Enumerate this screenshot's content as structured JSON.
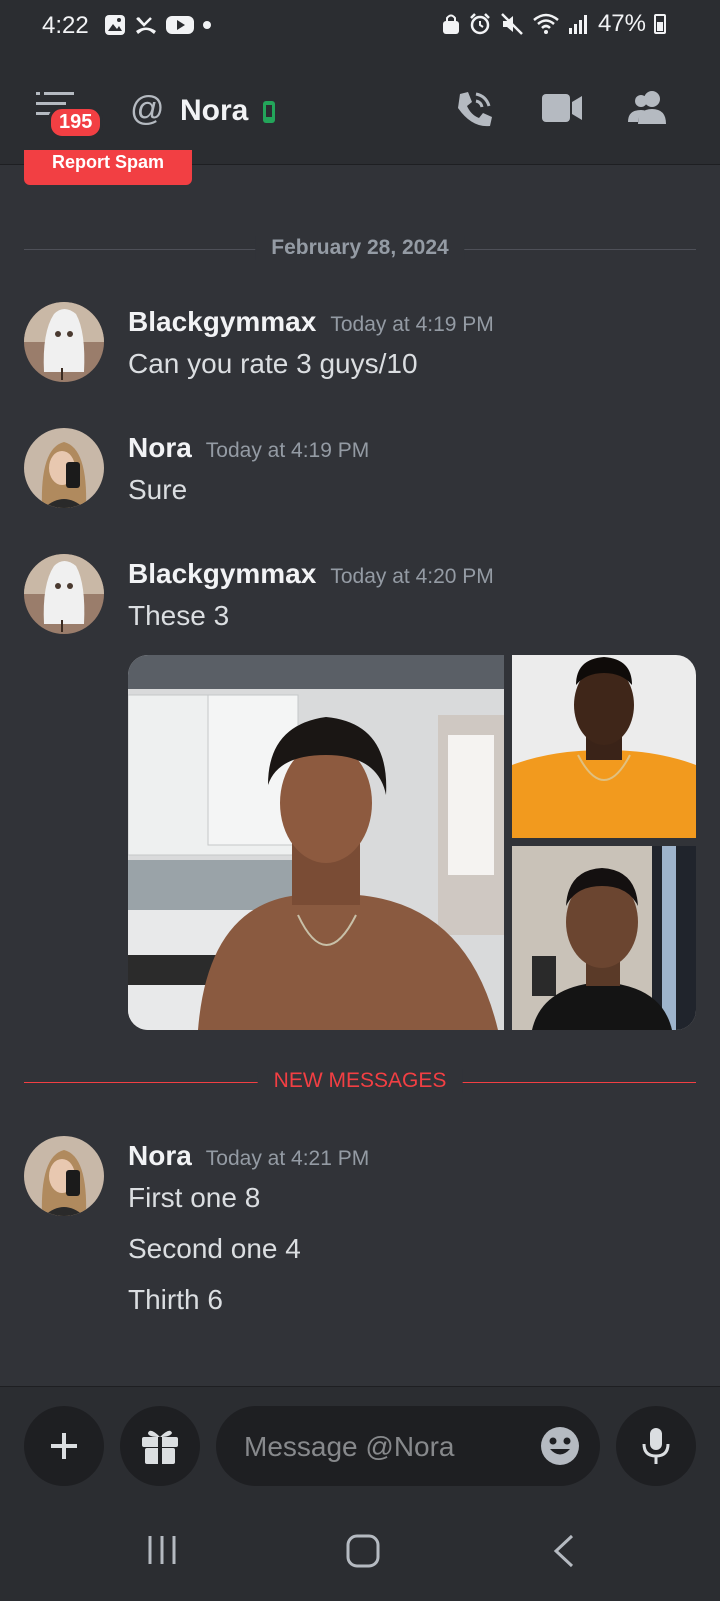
{
  "status_bar": {
    "time": "4:22",
    "battery_percent": "47%"
  },
  "header": {
    "unread_count": "195",
    "name": "Nora",
    "at_symbol": "@"
  },
  "report_button": {
    "label": "Report Spam"
  },
  "date_separator": "February 28, 2024",
  "new_messages_label": "NEW MESSAGES",
  "messages": [
    {
      "author": "Blackgymmax",
      "timestamp": "Today at 4:19 PM",
      "lines": [
        "Can you rate 3 guys/10"
      ]
    },
    {
      "author": "Nora",
      "timestamp": "Today at 4:19 PM",
      "lines": [
        "Sure"
      ]
    },
    {
      "author": "Blackgymmax",
      "timestamp": "Today at 4:20 PM",
      "lines": [
        "These 3"
      ]
    },
    {
      "author": "Nora",
      "timestamp": "Today at 4:21 PM",
      "lines": [
        "First one 8",
        "Second one 4",
        "Thirth 6"
      ]
    }
  ],
  "composer": {
    "placeholder": "Message @Nora"
  },
  "colors": {
    "background": "#313338",
    "header": "#2b2d31",
    "red": "#f23f43",
    "online_green": "#23a55a"
  }
}
